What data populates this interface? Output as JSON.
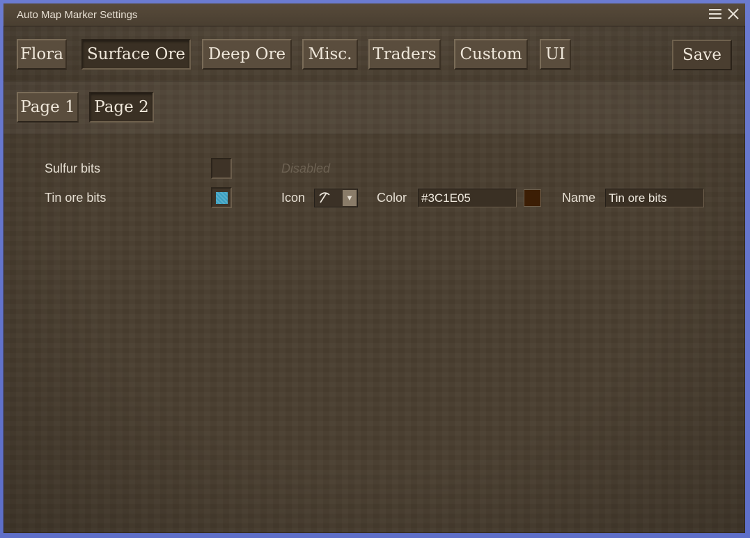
{
  "window": {
    "title": "Auto Map Marker Settings",
    "menu_icon": "hamburger-icon",
    "close_icon": "close-icon"
  },
  "tabs": [
    {
      "label": "Flora",
      "active": false
    },
    {
      "label": "Surface Ore",
      "active": true
    },
    {
      "label": "Deep Ore",
      "active": false
    },
    {
      "label": "Misc.",
      "active": false
    },
    {
      "label": "Traders",
      "active": false
    },
    {
      "label": "Custom",
      "active": false
    },
    {
      "label": "UI",
      "active": false
    }
  ],
  "save_label": "Save",
  "pages": [
    {
      "label": "Page 1",
      "active": false
    },
    {
      "label": "Page 2",
      "active": true
    }
  ],
  "rows": [
    {
      "label": "Sulfur bits",
      "enabled": false,
      "disabled_text": "Disabled"
    },
    {
      "label": "Tin ore bits",
      "enabled": true,
      "icon_label": "Icon",
      "icon_value": "pickaxe-icon",
      "color_label": "Color",
      "color_value": "#3C1E05",
      "name_label": "Name",
      "name_value": "Tin ore bits"
    }
  ],
  "colors": {
    "swatch": "#3C1E05",
    "checkbox_on": "#3a9fc0"
  }
}
